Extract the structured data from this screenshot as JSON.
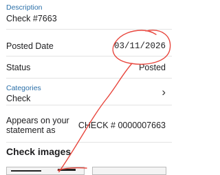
{
  "description": {
    "label": "Description",
    "value": "Check #7663"
  },
  "posted_date": {
    "label": "Posted Date",
    "value": "03/11/2026"
  },
  "status": {
    "label": "Status",
    "value": "Posted"
  },
  "categories": {
    "label": "Categories",
    "value": "Check",
    "chevron": "›"
  },
  "statement": {
    "label_line1": "Appears on your",
    "label_line2": "statement as",
    "value": "CHECK # 0000007663"
  },
  "check_images": {
    "heading": "Check images"
  },
  "colors": {
    "accent_blue": "#2a6fa8",
    "annotation_red": "#e8453c"
  },
  "icons": {
    "categories_row": "chevron-right-icon"
  }
}
